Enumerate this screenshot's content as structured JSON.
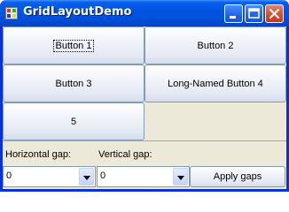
{
  "window": {
    "title": "GridLayoutDemo"
  },
  "titlebar_buttons": [
    {
      "name": "minimize",
      "icon": "minimize-icon"
    },
    {
      "name": "maximize",
      "icon": "maximize-icon"
    },
    {
      "name": "close",
      "icon": "close-icon"
    }
  ],
  "grid": {
    "buttons": [
      "Button 1",
      "Button 2",
      "Button 3",
      "Long-Named Button 4",
      "5"
    ]
  },
  "controls": {
    "hgap_label": "Horizontal gap:",
    "vgap_label": "Vertical gap:",
    "hgap_value": "0",
    "vgap_value": "0",
    "apply_label": "Apply gaps"
  },
  "colors": {
    "titlebar": "#0054e3",
    "client": "#ece9d8",
    "close_button": "#d34a2b"
  }
}
